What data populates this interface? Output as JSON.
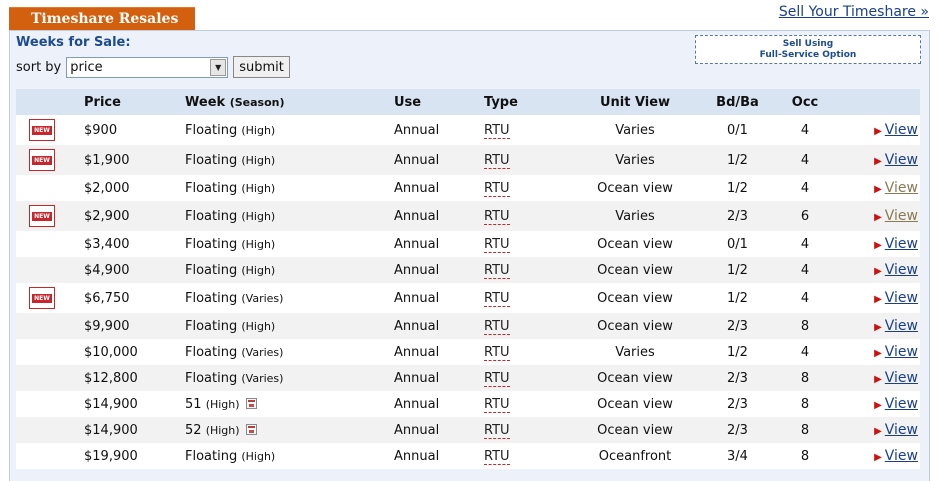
{
  "header": {
    "tab_title": "Timeshare Resales",
    "sell_link": "Sell Your Timeshare »"
  },
  "controls": {
    "weeks_label": "Weeks for Sale:",
    "sort_label": "sort by",
    "sort_value": "price",
    "submit_label": "submit",
    "fullservice_line1": "Sell Using",
    "fullservice_line2": "Full-Service Option"
  },
  "table": {
    "headers": {
      "price": "Price",
      "week": "Week",
      "week_sub": "(Season)",
      "use": "Use",
      "type": "Type",
      "unit_view": "Unit View",
      "bdba": "Bd/Ba",
      "occ": "Occ"
    },
    "new_badge_text": "NEW",
    "view_label": "View",
    "rows": [
      {
        "new": true,
        "price": "$900",
        "week": "Floating",
        "season": "(High)",
        "cal": false,
        "use": "Annual",
        "type": "RTU",
        "unit_view": "Varies",
        "bdba": "0/1",
        "occ": "4",
        "visited": false
      },
      {
        "new": true,
        "price": "$1,900",
        "week": "Floating",
        "season": "(High)",
        "cal": false,
        "use": "Annual",
        "type": "RTU",
        "unit_view": "Varies",
        "bdba": "1/2",
        "occ": "4",
        "visited": false
      },
      {
        "new": false,
        "price": "$2,000",
        "week": "Floating",
        "season": "(High)",
        "cal": false,
        "use": "Annual",
        "type": "RTU",
        "unit_view": "Ocean view",
        "bdba": "1/2",
        "occ": "4",
        "visited": true
      },
      {
        "new": true,
        "price": "$2,900",
        "week": "Floating",
        "season": "(High)",
        "cal": false,
        "use": "Annual",
        "type": "RTU",
        "unit_view": "Varies",
        "bdba": "2/3",
        "occ": "6",
        "visited": true
      },
      {
        "new": false,
        "price": "$3,400",
        "week": "Floating",
        "season": "(High)",
        "cal": false,
        "use": "Annual",
        "type": "RTU",
        "unit_view": "Ocean view",
        "bdba": "0/1",
        "occ": "4",
        "visited": false
      },
      {
        "new": false,
        "price": "$4,900",
        "week": "Floating",
        "season": "(High)",
        "cal": false,
        "use": "Annual",
        "type": "RTU",
        "unit_view": "Ocean view",
        "bdba": "1/2",
        "occ": "4",
        "visited": false
      },
      {
        "new": true,
        "price": "$6,750",
        "week": "Floating",
        "season": "(Varies)",
        "cal": false,
        "use": "Annual",
        "type": "RTU",
        "unit_view": "Ocean view",
        "bdba": "1/2",
        "occ": "4",
        "visited": false
      },
      {
        "new": false,
        "price": "$9,900",
        "week": "Floating",
        "season": "(High)",
        "cal": false,
        "use": "Annual",
        "type": "RTU",
        "unit_view": "Ocean view",
        "bdba": "2/3",
        "occ": "8",
        "visited": false
      },
      {
        "new": false,
        "price": "$10,000",
        "week": "Floating",
        "season": "(Varies)",
        "cal": false,
        "use": "Annual",
        "type": "RTU",
        "unit_view": "Varies",
        "bdba": "1/2",
        "occ": "4",
        "visited": false
      },
      {
        "new": false,
        "price": "$12,800",
        "week": "Floating",
        "season": "(Varies)",
        "cal": false,
        "use": "Annual",
        "type": "RTU",
        "unit_view": "Ocean view",
        "bdba": "2/3",
        "occ": "8",
        "visited": false
      },
      {
        "new": false,
        "price": "$14,900",
        "week": "51",
        "season": "(High)",
        "cal": true,
        "use": "Annual",
        "type": "RTU",
        "unit_view": "Ocean view",
        "bdba": "2/3",
        "occ": "8",
        "visited": false
      },
      {
        "new": false,
        "price": "$14,900",
        "week": "52",
        "season": "(High)",
        "cal": true,
        "use": "Annual",
        "type": "RTU",
        "unit_view": "Ocean view",
        "bdba": "2/3",
        "occ": "8",
        "visited": false
      },
      {
        "new": false,
        "price": "$19,900",
        "week": "Floating",
        "season": "(High)",
        "cal": false,
        "use": "Annual",
        "type": "RTU",
        "unit_view": "Oceanfront",
        "bdba": "3/4",
        "occ": "8",
        "visited": false
      }
    ]
  }
}
